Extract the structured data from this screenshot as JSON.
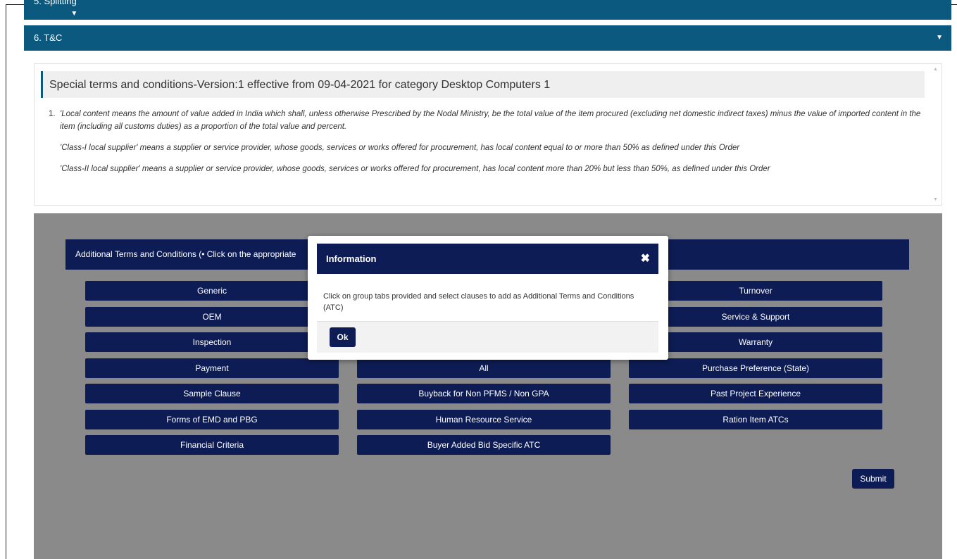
{
  "accordion": {
    "prev_section": "5. Splitting",
    "current_section": "6. T&C",
    "caret": "▼"
  },
  "special_terms": {
    "title": "Special terms and conditions-Version:1 effective from 09-04-2021 for category Desktop Computers 1",
    "item_number": "1.",
    "paragraphs": [
      "'Local content means the amount of value added in India which shall, unless otherwise Prescribed by the Nodal Ministry, be the total value of the item procured (excluding net domestic indirect taxes) minus the value of imported content in the item (including all customs duties) as a proportion of the total value and percent.",
      "'Class-I local supplier' means a supplier or service provider, whose goods, services or works offered for procurement, has local content equal to or more than 50% as defined under this Order",
      "'Class-II local supplier' means a supplier or service provider, whose goods, services or works offered for procurement, has local content more than 20% but less than 50%, as defined under this Order"
    ]
  },
  "atc": {
    "header": "Additional Terms and Conditions (• Click on the appropriate",
    "buttons": [
      "Generic",
      "Turnover",
      "OEM",
      "Service & Support",
      "Inspection",
      "Warranty",
      "Payment",
      "All",
      "Purchase Preference (State)",
      "Sample Clause",
      "Buyback for Non PFMS / Non GPA",
      "Past Project Experience",
      "Forms of EMD and PBG",
      "Human Resource Service",
      "Ration Item ATCs",
      "Financial Criteria",
      "Buyer Added Bid Specific ATC"
    ],
    "submit_label": "Submit"
  },
  "modal": {
    "title": "Information",
    "close_symbol": "✖",
    "message": "Click on group tabs provided and select clauses to add as Additional Terms and Conditions (ATC)",
    "ok_label": "Ok"
  }
}
